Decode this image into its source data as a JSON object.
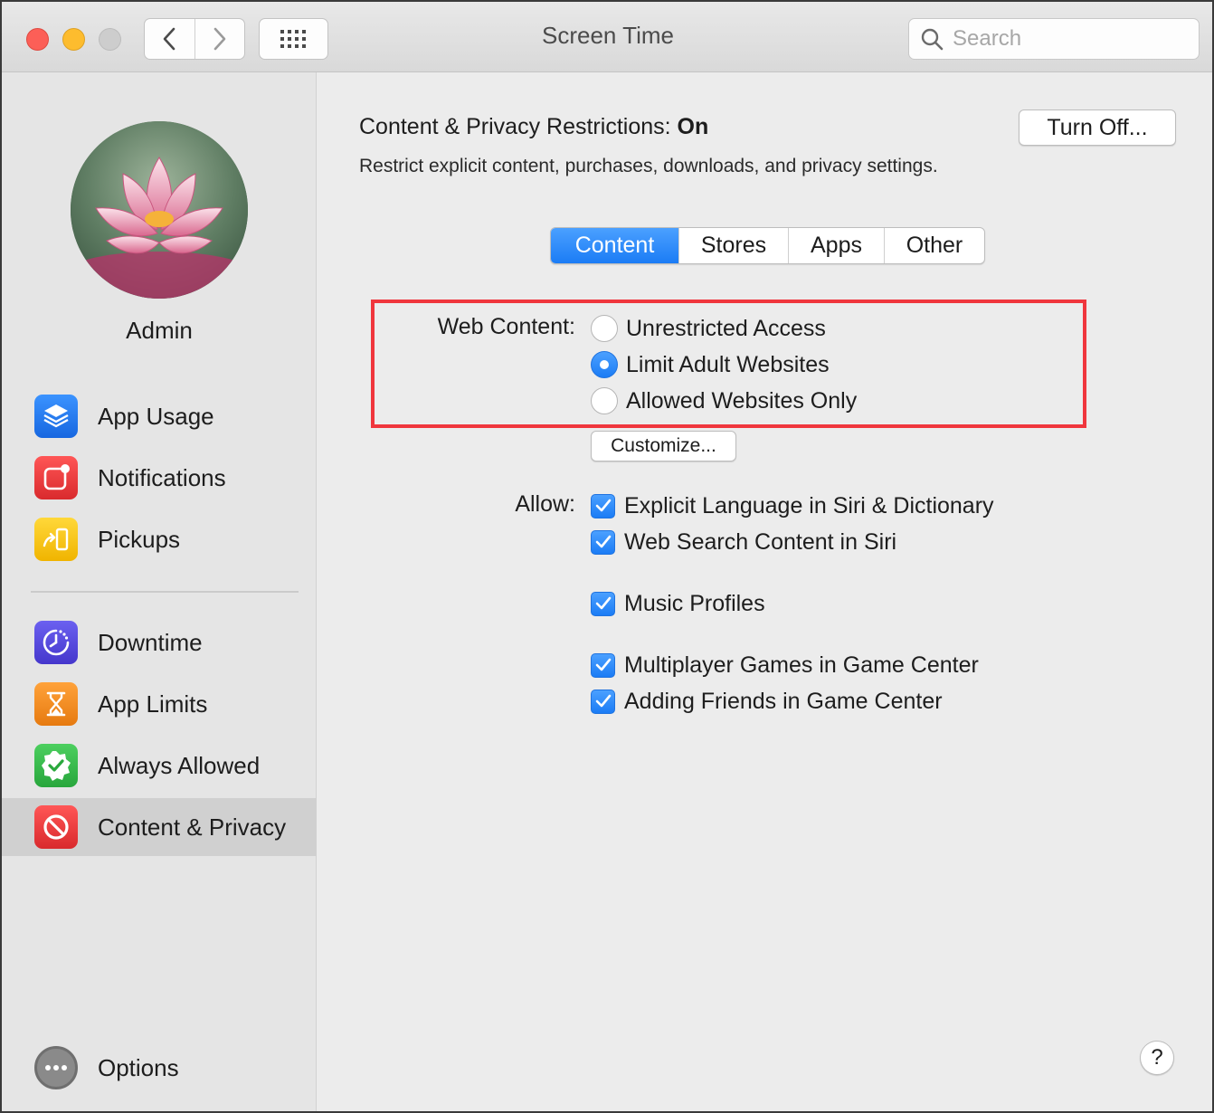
{
  "window": {
    "title": "Screen Time"
  },
  "toolbar": {
    "back_icon": "chevron-left-icon",
    "forward_icon": "chevron-right-icon",
    "grid_icon": "grid-icon"
  },
  "search": {
    "placeholder": "Search",
    "value": ""
  },
  "sidebar": {
    "user_name": "Admin",
    "usage_items": [
      {
        "label": "App Usage",
        "icon": "layers-icon",
        "color": "#1e7ef2"
      },
      {
        "label": "Notifications",
        "icon": "notification-badge-icon",
        "color": "#ec3a3b"
      },
      {
        "label": "Pickups",
        "icon": "pickup-phone-icon",
        "color": "#f5c400"
      }
    ],
    "limit_items": [
      {
        "label": "Downtime",
        "icon": "downtime-clock-icon",
        "color": "#5a4fe0"
      },
      {
        "label": "App Limits",
        "icon": "hourglass-icon",
        "color": "#f08a1a"
      },
      {
        "label": "Always Allowed",
        "icon": "checkmark-badge-icon",
        "color": "#36b94a"
      },
      {
        "label": "Content & Privacy",
        "icon": "no-entry-icon",
        "color": "#ec3a3b",
        "selected": true
      }
    ],
    "options_label": "Options"
  },
  "main": {
    "restrictions_label": "Content & Privacy Restrictions:",
    "restrictions_state": "On",
    "turn_off_label": "Turn Off...",
    "description": "Restrict explicit content, purchases, downloads, and privacy settings.",
    "tabs": [
      {
        "label": "Content",
        "active": true
      },
      {
        "label": "Stores",
        "active": false
      },
      {
        "label": "Apps",
        "active": false
      },
      {
        "label": "Other",
        "active": false
      }
    ],
    "web_content_label": "Web Content:",
    "web_content_options": [
      {
        "label": "Unrestricted Access",
        "selected": false
      },
      {
        "label": "Limit Adult Websites",
        "selected": true
      },
      {
        "label": "Allowed Websites Only",
        "selected": false
      }
    ],
    "customize_label": "Customize...",
    "allow_label": "Allow:",
    "allow_options": [
      {
        "label": "Explicit Language in Siri & Dictionary",
        "checked": true
      },
      {
        "label": "Web Search Content in Siri",
        "checked": true
      },
      {
        "label": "Music Profiles",
        "checked": true
      },
      {
        "label": "Multiplayer Games in Game Center",
        "checked": true
      },
      {
        "label": "Adding Friends in Game Center",
        "checked": true
      }
    ],
    "help_label": "?"
  },
  "colors": {
    "accent": "#1b7cf5",
    "highlight_border": "#f0363d",
    "sidebar_bg": "#e5e5e5",
    "content_bg": "#ececec"
  }
}
